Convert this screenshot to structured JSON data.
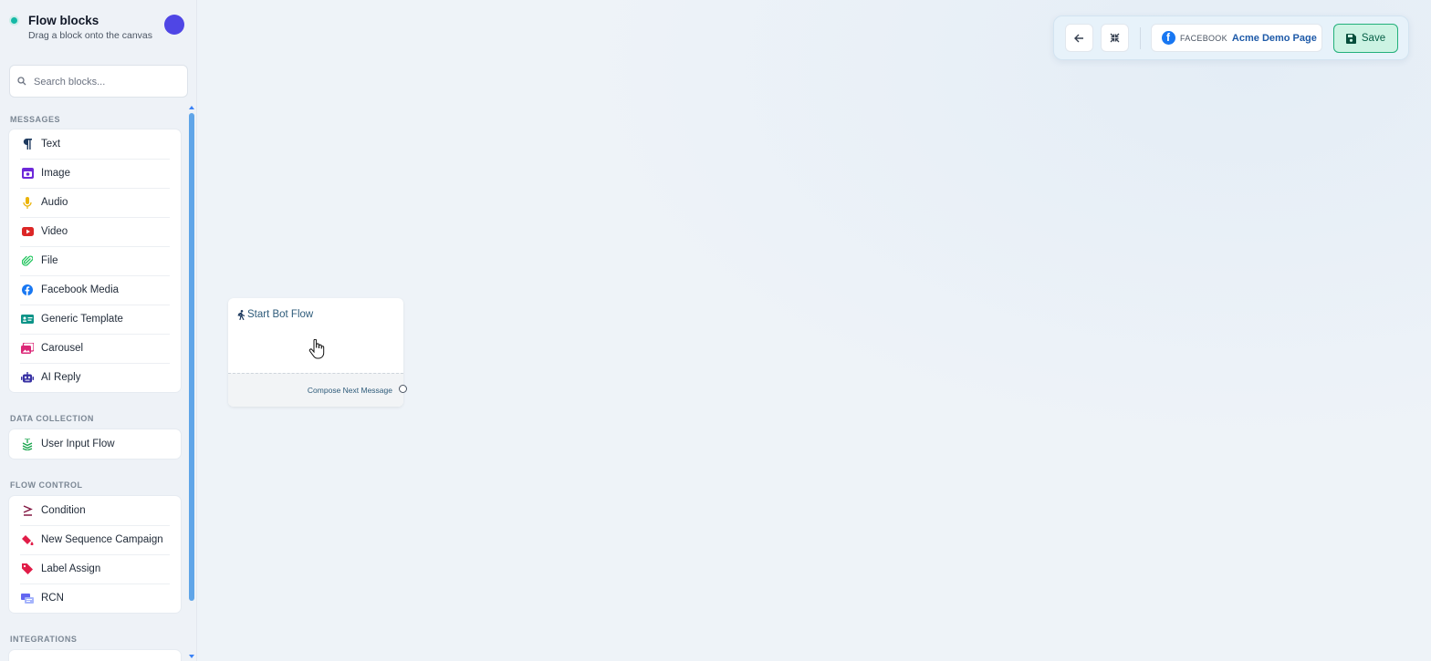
{
  "sidebar": {
    "title": "Flow blocks",
    "subtitle": "Drag a block onto the canvas",
    "search_placeholder": "Search blocks...",
    "sections": [
      {
        "label": "MESSAGES",
        "items": [
          {
            "label": "Text",
            "icon": "paragraph-icon",
            "color": "#1e3a5f"
          },
          {
            "label": "Image",
            "icon": "image-icon",
            "color": "#6d28d9"
          },
          {
            "label": "Audio",
            "icon": "microphone-icon",
            "color": "#eab308"
          },
          {
            "label": "Video",
            "icon": "youtube-icon",
            "color": "#dc2626"
          },
          {
            "label": "File",
            "icon": "paperclip-icon",
            "color": "#22c55e"
          },
          {
            "label": "Facebook Media",
            "icon": "facebook-icon",
            "color": "#1877f2"
          },
          {
            "label": "Generic Template",
            "icon": "id-card-icon",
            "color": "#0d9488"
          },
          {
            "label": "Carousel",
            "icon": "images-icon",
            "color": "#db2777"
          },
          {
            "label": "AI Reply",
            "icon": "robot-icon",
            "color": "#3730a3"
          }
        ]
      },
      {
        "label": "DATA COLLECTION",
        "items": [
          {
            "label": "User Input Flow",
            "icon": "layer-group-icon",
            "color": "#16a34a"
          }
        ]
      },
      {
        "label": "FLOW CONTROL",
        "items": [
          {
            "label": "Condition",
            "icon": "greater-equal-icon",
            "color": "#831843"
          },
          {
            "label": "New Sequence Campaign",
            "icon": "paint-bucket-icon",
            "color": "#e11d48"
          },
          {
            "label": "Label Assign",
            "icon": "tags-icon",
            "color": "#e11d48"
          },
          {
            "label": "RCN",
            "icon": "rcn-icon",
            "color": "#6366f1"
          }
        ]
      },
      {
        "label": "INTEGRATIONS",
        "items": []
      }
    ]
  },
  "toolbar": {
    "platform": "FACEBOOK",
    "page_name": "Acme Demo Page",
    "save_label": "Save"
  },
  "node": {
    "title": "Start Bot Flow",
    "output_label": "Compose Next Message"
  },
  "colors": {
    "accent": "#4f46e5",
    "status_dot": "#14b8a6",
    "save_bg": "#ccf3e3",
    "save_border": "#22b07a",
    "facebook": "#1877f2"
  }
}
